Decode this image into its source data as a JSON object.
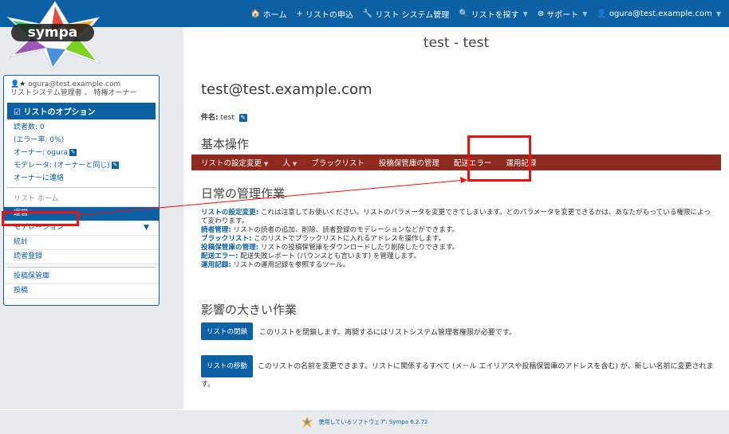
{
  "nav": {
    "home": "ホーム",
    "request": "リストの申込",
    "admin": "リスト システム管理",
    "search": "リストを探す",
    "support": "サポート",
    "user": "ogura@test.example.com"
  },
  "page_title": "test - test",
  "sidebar": {
    "user_email": "ogura@test.example.com",
    "user_roles": "リストシステム管理者 、 特権オーナー",
    "options_header": "リストのオプション",
    "subscribers": "読者数: 0",
    "error_rate": "(エラー率: 0%)",
    "owner": "オーナー: ogura",
    "moderator": "モデレータ: (オーナーと同じ)",
    "contact_owner": "オーナーに連絡",
    "items": [
      {
        "label": "リスト ホーム",
        "state": "muted"
      },
      {
        "label": "運営",
        "state": "active"
      },
      {
        "label": "モデレーション",
        "state": "normal"
      },
      {
        "label": "統計",
        "state": "normal"
      },
      {
        "label": "読者登録",
        "state": "normal"
      }
    ],
    "items2": [
      {
        "label": "投稿保管庫"
      },
      {
        "label": "投稿"
      }
    ]
  },
  "main": {
    "list_address": "test@test.example.com",
    "subject_label": "件名:",
    "subject_value": "test",
    "basic_ops_title": "基本操作",
    "ops": [
      {
        "label": "リストの設定変更",
        "has_menu": true
      },
      {
        "label": "人",
        "has_menu": true
      },
      {
        "label": "ブラックリスト",
        "has_menu": false
      },
      {
        "label": "投稿保管庫の管理",
        "has_menu": false
      },
      {
        "label": "配送エラー",
        "has_menu": false
      },
      {
        "label": "運用記録",
        "has_menu": false
      }
    ],
    "daily_title": "日常の管理作業",
    "descriptions": [
      {
        "term": "リストの設定変更:",
        "text": "これは注意してお使いください。リストのパラメータを変更できてしまいます。どのパラメータを変更できるかは、あなたがもっている権限によって変わります。"
      },
      {
        "term": "読者管理:",
        "text": "リストの読者の追加、削除、読者登録のモデレーションなどができます。"
      },
      {
        "term": "ブラックリスト:",
        "text": "このリストでブラックリストに入れるアドレスを操作します。"
      },
      {
        "term": "投稿保管庫の管理:",
        "text": "リストの投稿保管庫をダウンロードしたり削除したりできます。"
      },
      {
        "term": "配送エラー:",
        "text": "配送失敗レポート (バウンスとも言います) を管理します。"
      },
      {
        "term": "運用記録:",
        "text": "リストの運用記録を参照するツール。"
      }
    ],
    "impact_title": "影響の大きい作業",
    "close_button": "リストの閉鎖",
    "close_text": "このリストを閉鎖します。再開するにはリストシステム管理者権限が必要です。",
    "move_button": "リストの移動",
    "move_text": "このリストの名前を変更できます。リストに関係するすべて (メール エイリアスや投稿保管庫のアドレスを含む) が、新しい名前に変更されます。"
  },
  "footer": {
    "text": "使用しているソフトウェア: Sympa 6.2.72"
  },
  "colors": {
    "nav_blue": "#0b61a4",
    "op_bar": "#8e2a1e",
    "annotation_red": "#ee1111"
  }
}
